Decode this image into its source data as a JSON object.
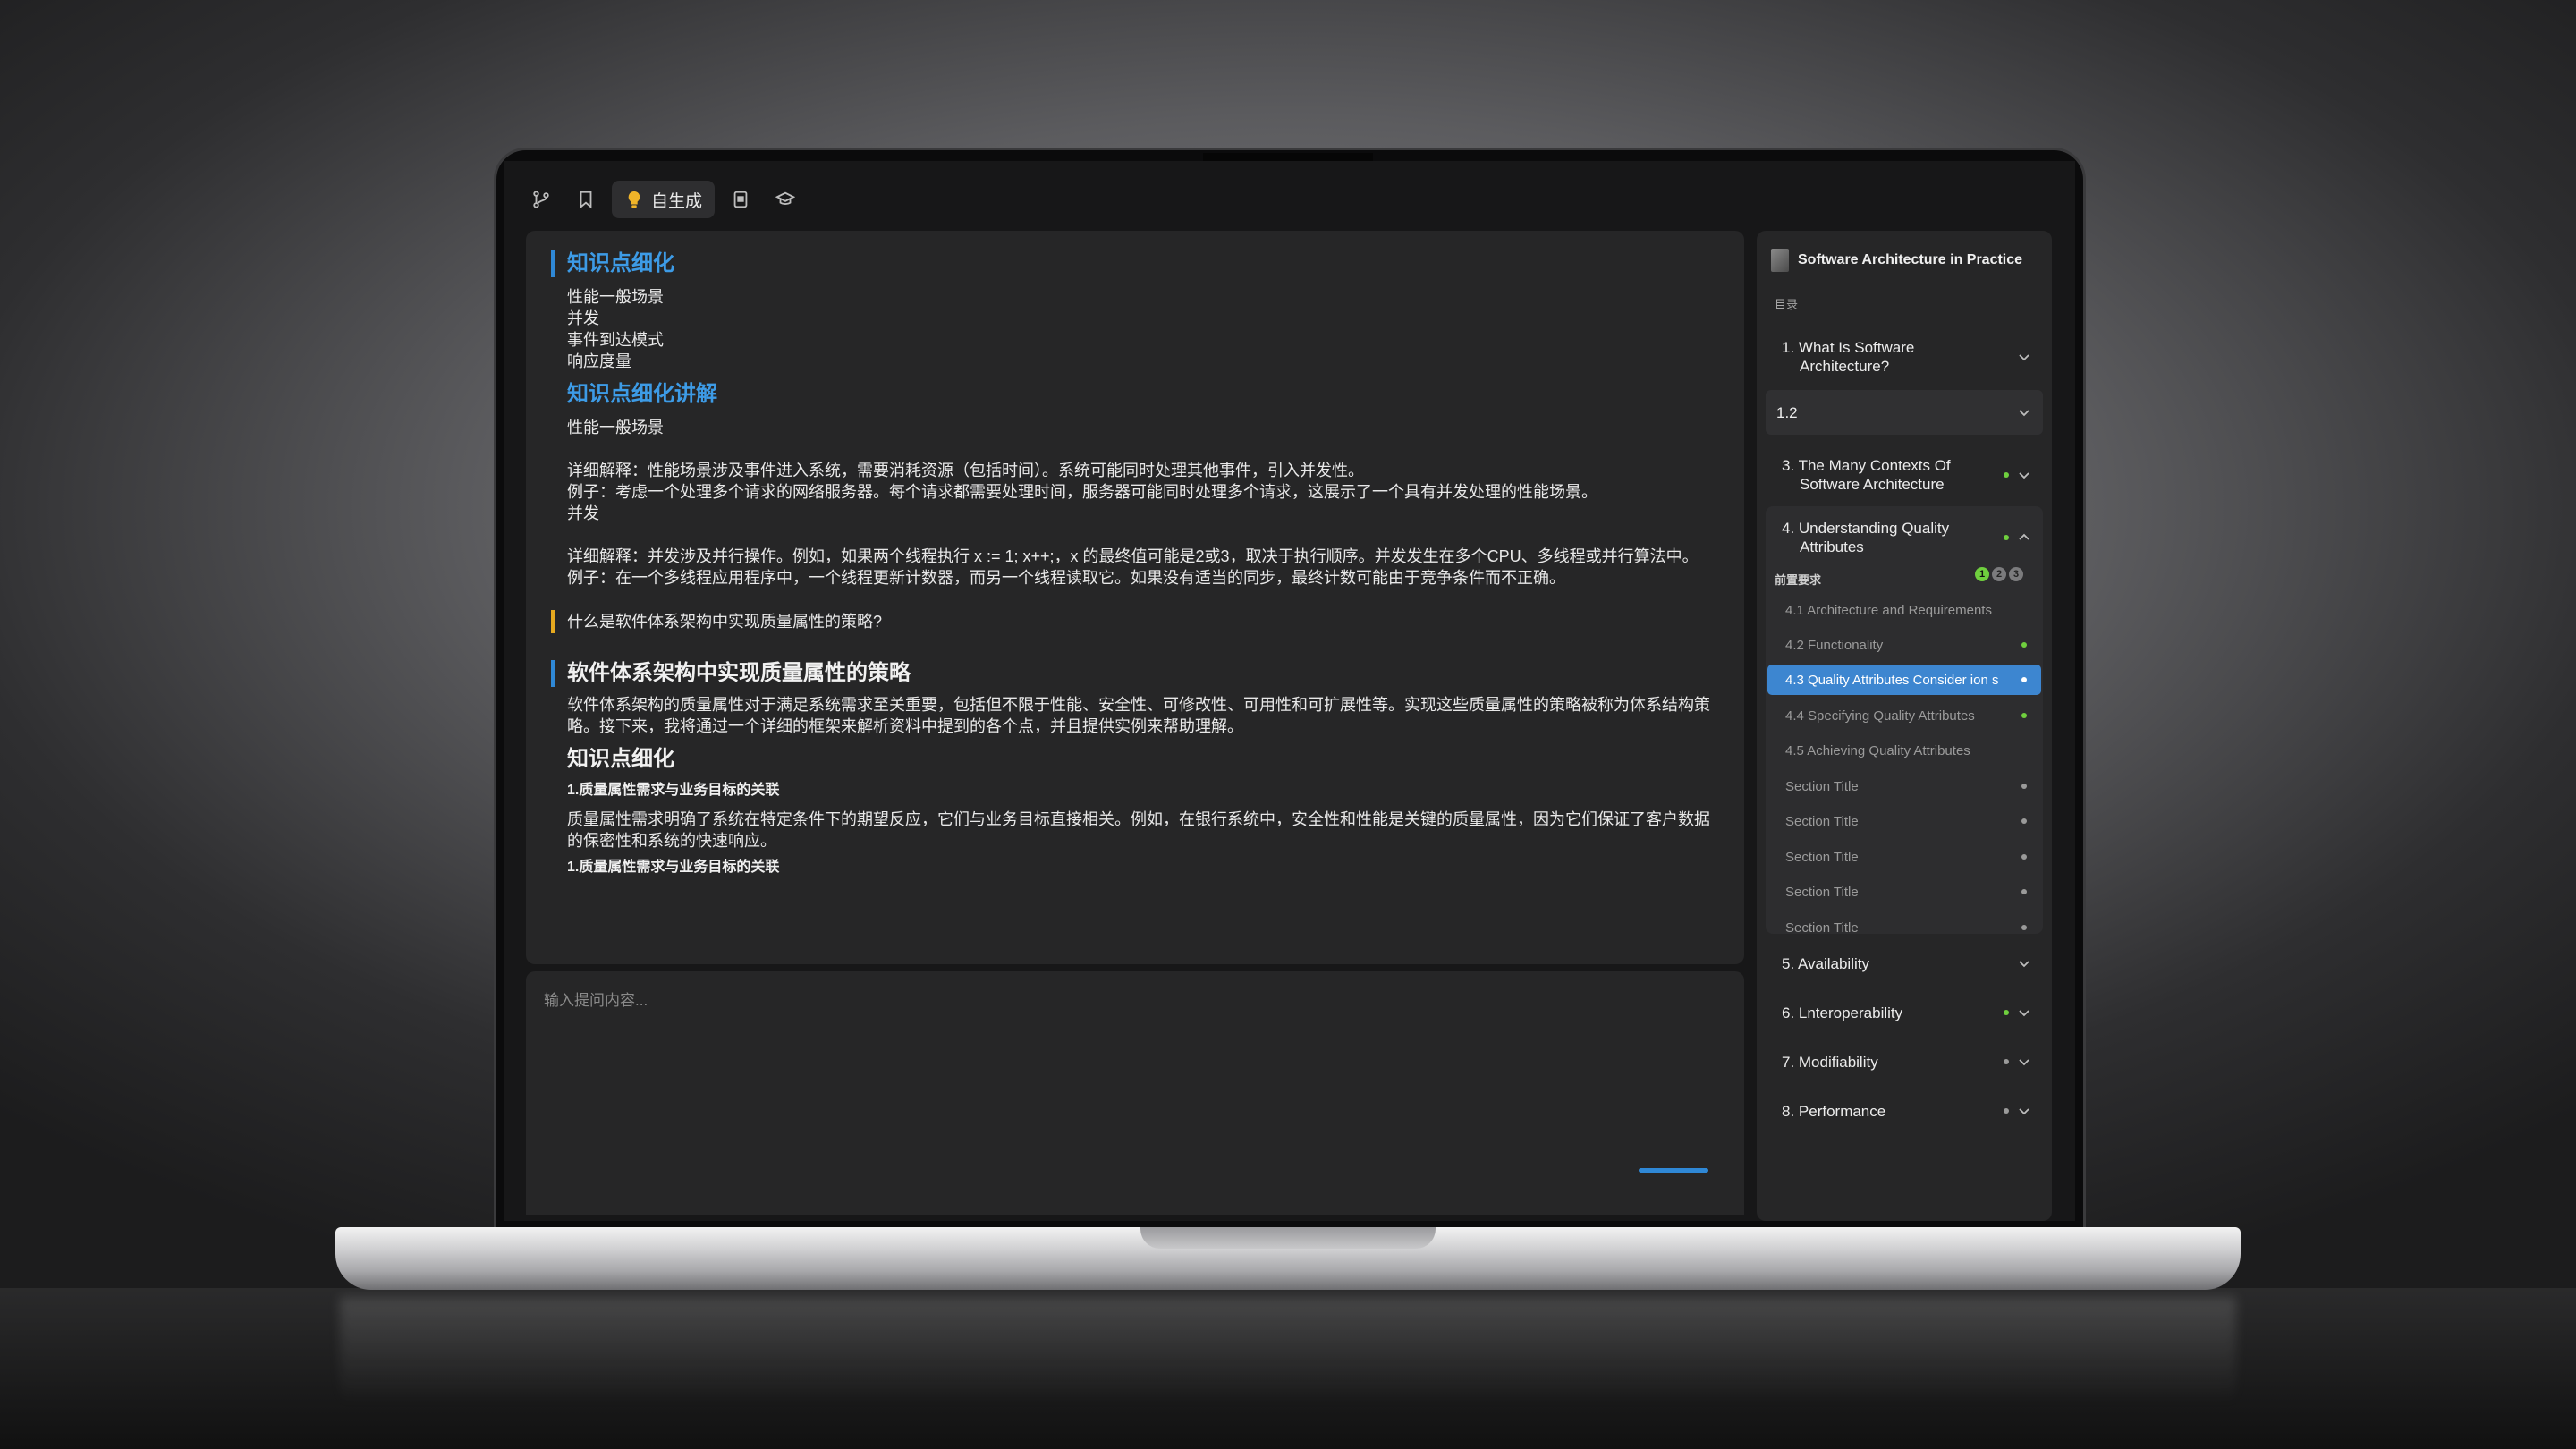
{
  "toolbar": {
    "active_label": "自生成"
  },
  "chat": {
    "sec1_title": "知识点细化",
    "sec1_items": [
      "性能一般场景",
      "并发",
      "事件到达模式",
      "响应度量"
    ],
    "sec2_title": "知识点细化讲解",
    "sec2_sub": "性能一般场景",
    "p1": "详细解释：性能场景涉及事件进入系统，需要消耗资源（包括时间）。系统可能同时处理其他事件，引入并发性。",
    "p2": "例子：考虑一个处理多个请求的网络服务器。每个请求都需要处理时间，服务器可能同时处理多个请求，这展示了一个具有并发处理的性能场景。",
    "p3": "并发",
    "p4": "详细解释：并发涉及并行操作。例如，如果两个线程执行 x := 1; x++;，x 的最终值可能是2或3，取决于执行顺序。并发发生在多个CPU、多线程或并行算法中。",
    "p5": "例子：在一个多线程应用程序中，一个线程更新计数器，而另一个线程读取它。如果没有适当的同步，最终计数可能由于竞争条件而不正确。",
    "question": "什么是软件体系架构中实现质量属性的策略?",
    "answer_title": "软件体系架构中实现质量属性的策略",
    "answer_p1": "软件体系架构的质量属性对于满足系统需求至关重要，包括但不限于性能、安全性、可修改性、可用性和可扩展性等。实现这些质量属性的策略被称为体系结构策略。接下来，我将通过一个详细的框架来解析资料中提到的各个点，并且提供实例来帮助理解。",
    "answer_h2": "知识点细化",
    "answer_sub1": "1.质量属性需求与业务目标的关联",
    "answer_p2": "质量属性需求明确了系统在特定条件下的期望反应，它们与业务目标直接相关。例如，在银行系统中，安全性和性能是关键的质量属性，因为它们保证了客户数据的保密性和系统的快速响应。",
    "answer_sub2": "1.质量属性需求与业务目标的关联"
  },
  "input": {
    "placeholder": "输入提问内容..."
  },
  "sidebar": {
    "book_title": "Software Architecture in Practice",
    "toc_label": "目录",
    "chapters": [
      {
        "label": "1. What Is Software Architecture?",
        "line1": "1. What Is Software",
        "line2": "Architecture?"
      },
      {
        "label": "1.2"
      },
      {
        "line1": "3. The Many Contexts Of",
        "line2": "Software Architecture"
      },
      {
        "line1": "4. Understanding Quality",
        "line2": "Attributes"
      },
      {
        "label": "5. Availability"
      },
      {
        "label": "6. Lnteroperability"
      },
      {
        "label": "7. Modifiability"
      },
      {
        "label": "8. Performance"
      }
    ],
    "prereq_label": "前置要求",
    "prereq_badges": [
      "1",
      "2",
      "3"
    ],
    "sections": [
      "4.1 Architecture and Requirements",
      "4.2 Functionality",
      "4.3 Quality Attributes Consider ion s",
      "4.4 Specifying Quality Attributes",
      "4.5 Achieving Quality Attributes",
      "Section Title",
      "Section Title",
      "Section Title",
      "Section Title",
      "Section Title"
    ]
  }
}
